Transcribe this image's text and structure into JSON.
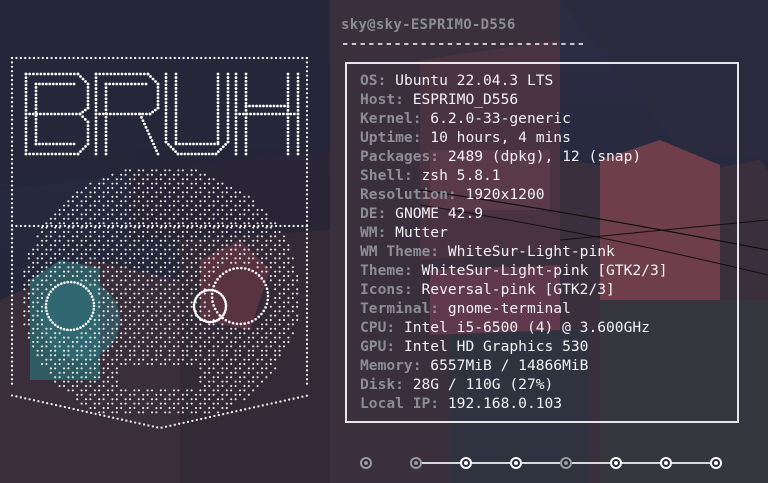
{
  "terminal": {
    "user_host": "sky@sky-ESPRIMO-D556",
    "separator": "----------------------------"
  },
  "logo": {
    "text": "BRUH"
  },
  "info": [
    {
      "key": "OS",
      "value": "Ubuntu 22.04.3 LTS"
    },
    {
      "key": "Host",
      "value": "ESPRIMO_D556"
    },
    {
      "key": "Kernel",
      "value": "6.2.0-33-generic"
    },
    {
      "key": "Uptime",
      "value": "10 hours, 4 mins"
    },
    {
      "key": "Packages",
      "value": "2489 (dpkg), 12 (snap)"
    },
    {
      "key": "Shell",
      "value": "zsh 5.8.1"
    },
    {
      "key": "Resolution",
      "value": "1920x1200"
    },
    {
      "key": "DE",
      "value": "GNOME 42.9"
    },
    {
      "key": "WM",
      "value": "Mutter"
    },
    {
      "key": "WM Theme",
      "value": "WhiteSur-Light-pink"
    },
    {
      "key": "Theme",
      "value": "WhiteSur-Light-pink [GTK2/3]"
    },
    {
      "key": "Icons",
      "value": "Reversal-pink [GTK2/3]"
    },
    {
      "key": "Terminal",
      "value": "gnome-terminal"
    },
    {
      "key": "CPU",
      "value": "Intel i5-6500 (4) @ 3.600GHz"
    },
    {
      "key": "GPU",
      "value": "Intel HD Graphics 530"
    },
    {
      "key": "Memory",
      "value": "6557MiB / 14866MiB"
    },
    {
      "key": "Disk",
      "value": "28G / 110G (27%)"
    },
    {
      "key": "Local IP",
      "value": "192.168.0.103"
    }
  ],
  "indicator": {
    "states": [
      false,
      false,
      true,
      true,
      false,
      true,
      true,
      true
    ]
  },
  "colors": {
    "key": "#8d8d96",
    "value": "#f2f2f4",
    "border": "#e6e6e8",
    "logo_dots": "#ffffff"
  }
}
